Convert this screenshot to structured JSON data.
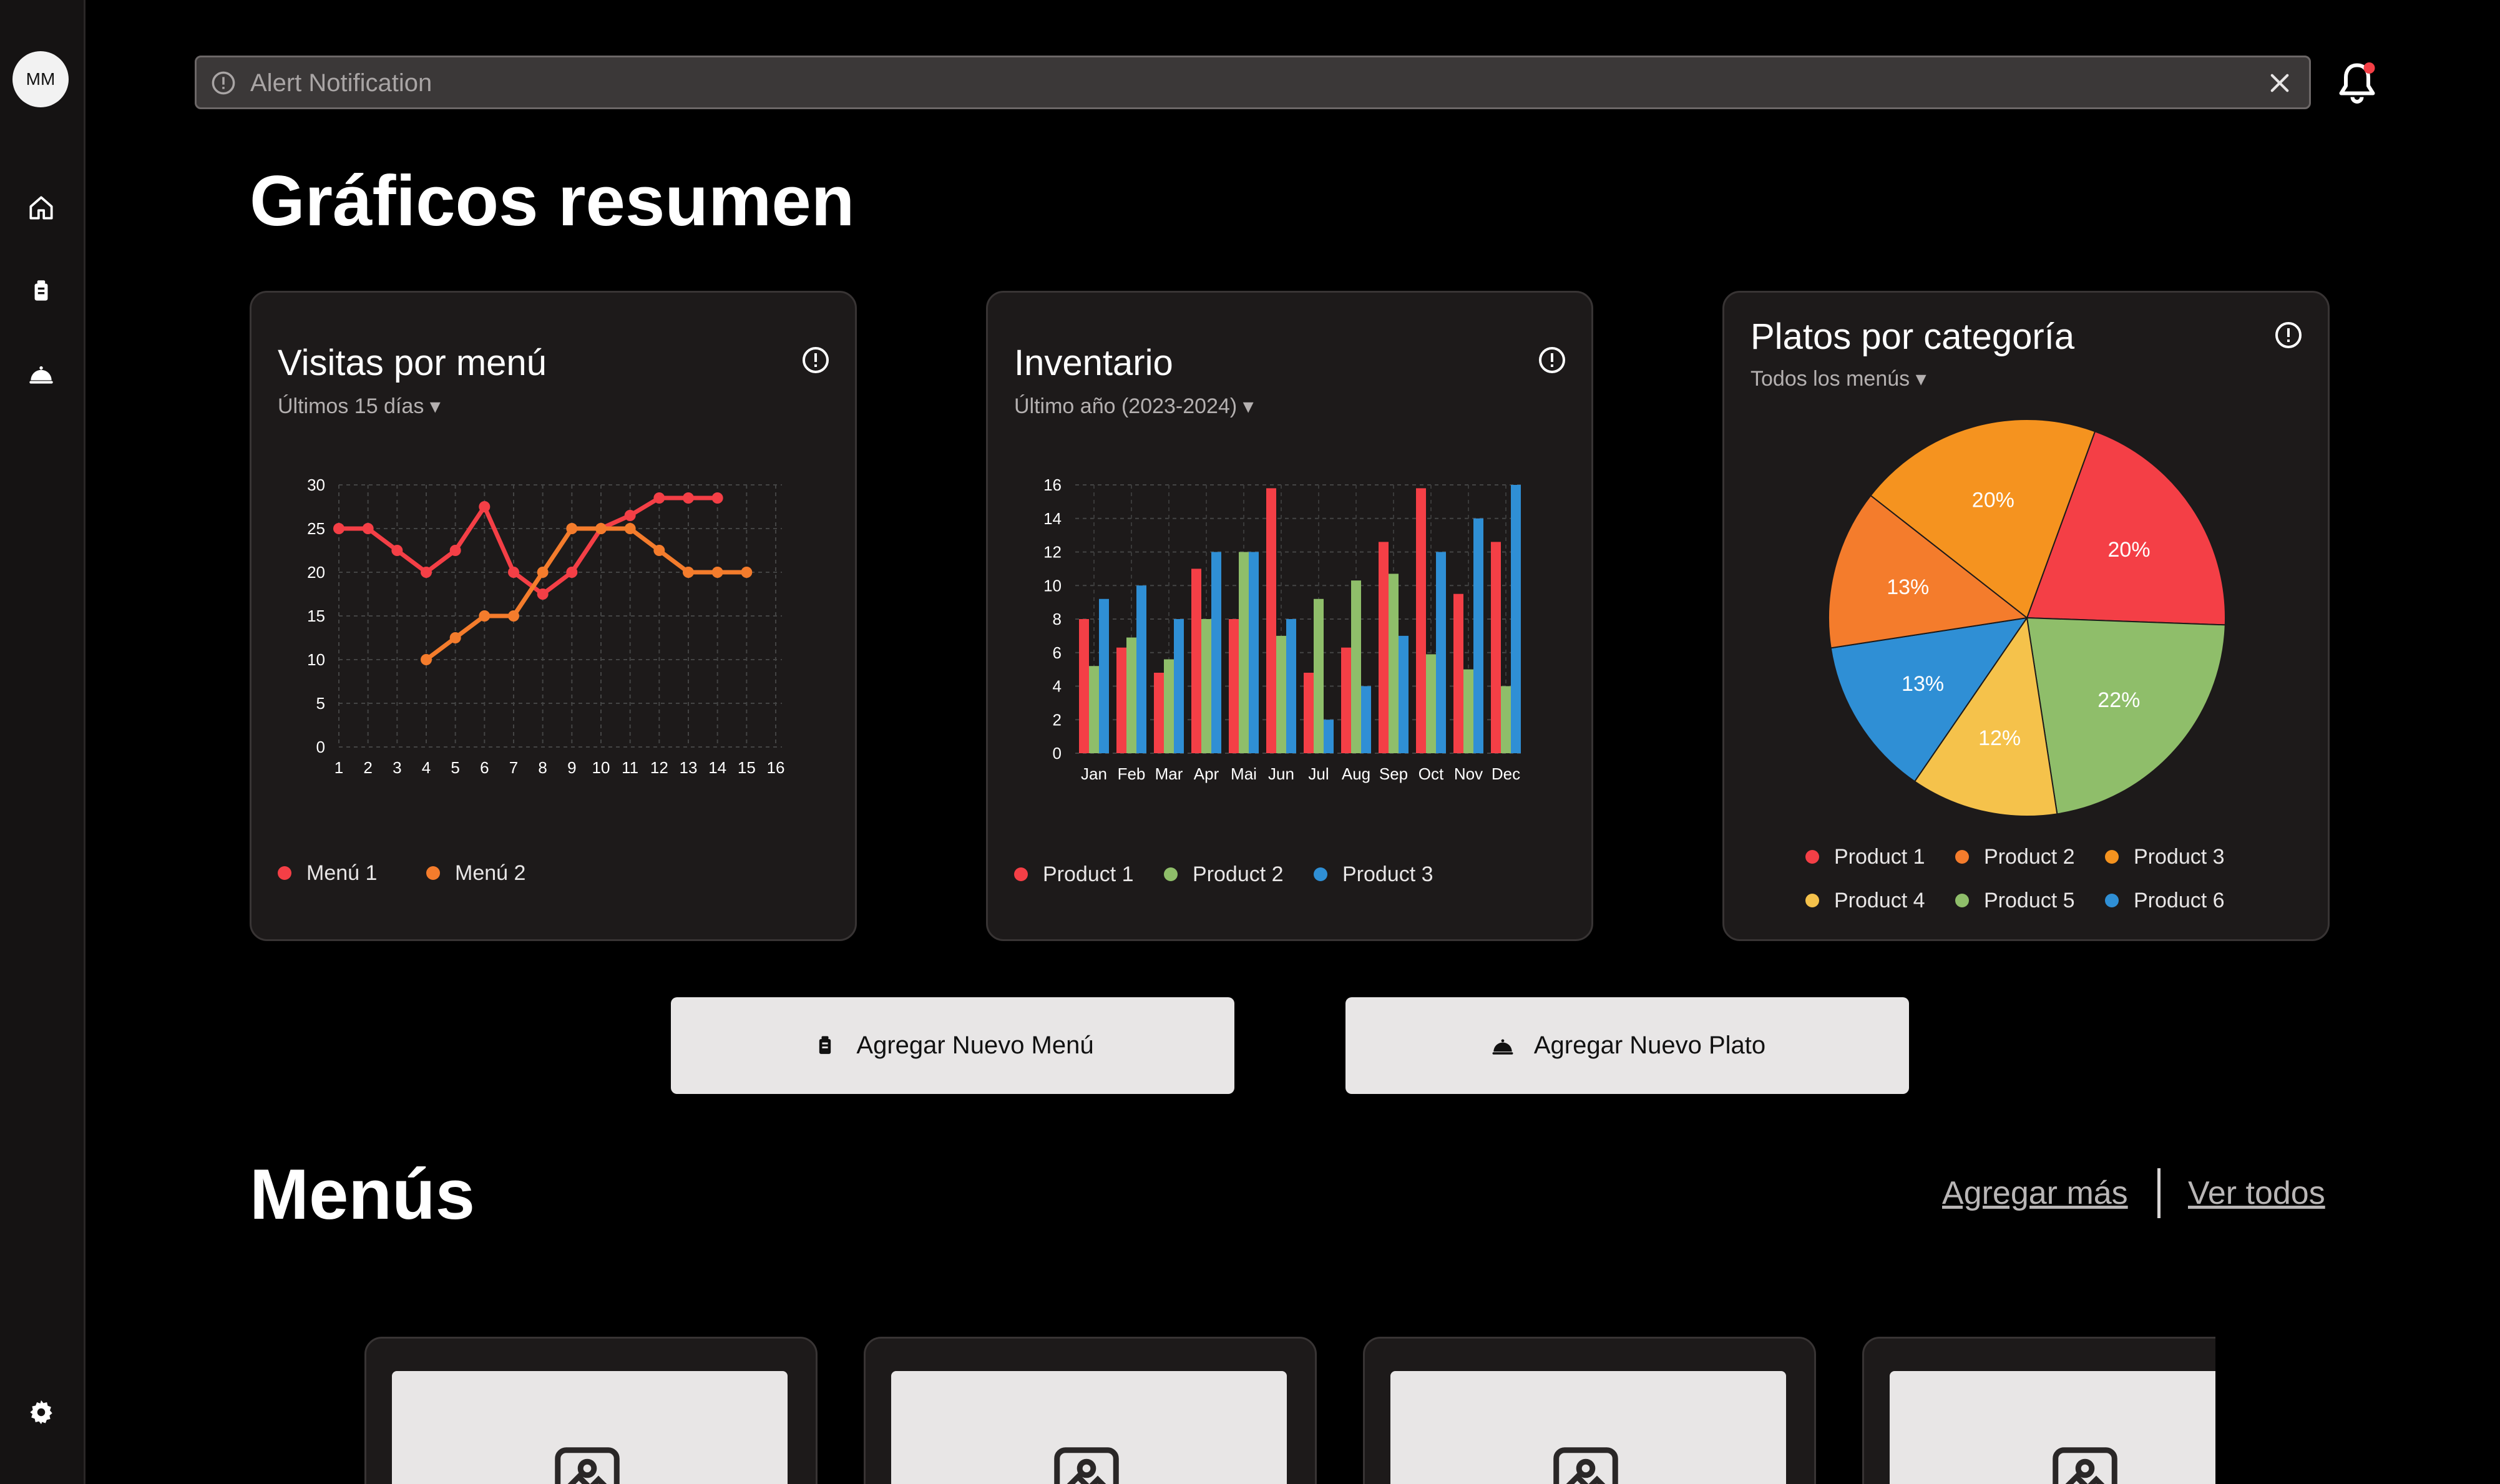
{
  "user": {
    "initials": "MM"
  },
  "sidebar": {
    "icons": [
      "home-icon",
      "menu-book-icon",
      "cloche-icon",
      "gear-icon"
    ]
  },
  "alert": {
    "text": "Alert Notification"
  },
  "page": {
    "title": "Gráficos resumen"
  },
  "colors": {
    "red": "#f43f46",
    "orange": "#f47c2c",
    "green": "#8fbe6a",
    "blue": "#2f8fd5",
    "amber": "#f5931f",
    "yellow": "#f5c24b"
  },
  "cards": {
    "visits": {
      "title": "Visitas por menú",
      "subtitle": "Últimos 15 días ▾"
    },
    "inventory": {
      "title": "Inventario",
      "subtitle": "Último año (2023-2024) ▾"
    },
    "categories": {
      "title": "Platos por categoría",
      "subtitle": "Todos los menús ▾"
    }
  },
  "chart_data": [
    {
      "type": "line",
      "x": [
        1,
        2,
        3,
        4,
        5,
        6,
        7,
        8,
        9,
        10,
        11,
        12,
        13,
        14,
        15,
        16
      ],
      "xlim": [
        1,
        16
      ],
      "ylim": [
        0,
        30
      ],
      "yticks": [
        0,
        5,
        10,
        15,
        20,
        25,
        30
      ],
      "grid": true,
      "legend_position": "bottom-left",
      "series": [
        {
          "name": "Menú 1",
          "color": "#f43f46",
          "points": [
            [
              1,
              25
            ],
            [
              2,
              25
            ],
            [
              3,
              22.5
            ],
            [
              4,
              20
            ],
            [
              5,
              22.5
            ],
            [
              6,
              27.5
            ],
            [
              7,
              20
            ],
            [
              8,
              17.5
            ],
            [
              9,
              20
            ],
            [
              10,
              25
            ],
            [
              11,
              26.5
            ],
            [
              12,
              28.5
            ],
            [
              13,
              28.5
            ],
            [
              14,
              28.5
            ]
          ]
        },
        {
          "name": "Menú 2",
          "color": "#f47c2c",
          "points": [
            [
              4,
              10
            ],
            [
              5,
              12.5
            ],
            [
              6,
              15
            ],
            [
              7,
              15
            ],
            [
              8,
              20
            ],
            [
              9,
              25
            ],
            [
              10,
              25
            ],
            [
              11,
              25
            ],
            [
              12,
              22.5
            ],
            [
              13,
              20
            ],
            [
              14,
              20
            ],
            [
              15,
              20
            ]
          ]
        }
      ]
    },
    {
      "type": "bar",
      "categories": [
        "Jan",
        "Feb",
        "Mar",
        "Apr",
        "Mai",
        "Jun",
        "Jul",
        "Aug",
        "Sep",
        "Oct",
        "Nov",
        "Dec"
      ],
      "ylim": [
        0,
        16
      ],
      "yticks": [
        0,
        2,
        4,
        6,
        8,
        10,
        12,
        14,
        16
      ],
      "grid": true,
      "legend_position": "bottom-left",
      "series": [
        {
          "name": "Product 1",
          "color": "#f43f46",
          "values": [
            8,
            6.3,
            4.8,
            11,
            8,
            15.8,
            4.8,
            6.3,
            12.6,
            15.8,
            9.5,
            12.6
          ]
        },
        {
          "name": "Product 2",
          "color": "#8fbe6a",
          "values": [
            5.2,
            6.9,
            5.6,
            8,
            12,
            7,
            9.2,
            10.3,
            10.7,
            5.9,
            5,
            4
          ]
        },
        {
          "name": "Product 3",
          "color": "#2f8fd5",
          "values": [
            9.2,
            10,
            8,
            12,
            12,
            8,
            2,
            4,
            7,
            12,
            14,
            16
          ]
        }
      ]
    },
    {
      "type": "pie",
      "legend_position": "bottom",
      "slices": [
        {
          "name": "Product 1",
          "value": 20,
          "label": "20%",
          "color": "#f43f46"
        },
        {
          "name": "Product 5",
          "value": 22,
          "label": "22%",
          "color": "#8fbe6a"
        },
        {
          "name": "Product 4",
          "value": 12,
          "label": "12%",
          "color": "#f5c24b"
        },
        {
          "name": "Product 6",
          "value": 13,
          "label": "13%",
          "color": "#2f8fd5"
        },
        {
          "name": "Product 2",
          "value": 13,
          "label": "13%",
          "color": "#f47c2c"
        },
        {
          "name": "Product 3",
          "value": 20,
          "label": "20%",
          "color": "#f5931f"
        }
      ],
      "legend": [
        {
          "name": "Product 1",
          "color": "#f43f46"
        },
        {
          "name": "Product 2",
          "color": "#f47c2c"
        },
        {
          "name": "Product 3",
          "color": "#f5931f"
        },
        {
          "name": "Product 4",
          "color": "#f5c24b"
        },
        {
          "name": "Product 5",
          "color": "#8fbe6a"
        },
        {
          "name": "Product 6",
          "color": "#2f8fd5"
        }
      ]
    }
  ],
  "actions": {
    "add_menu": "Agregar Nuevo Menú",
    "add_dish": "Agregar Nuevo Plato"
  },
  "menus": {
    "title": "Menús",
    "add_more": "Agregar más",
    "see_all": "Ver todos"
  }
}
